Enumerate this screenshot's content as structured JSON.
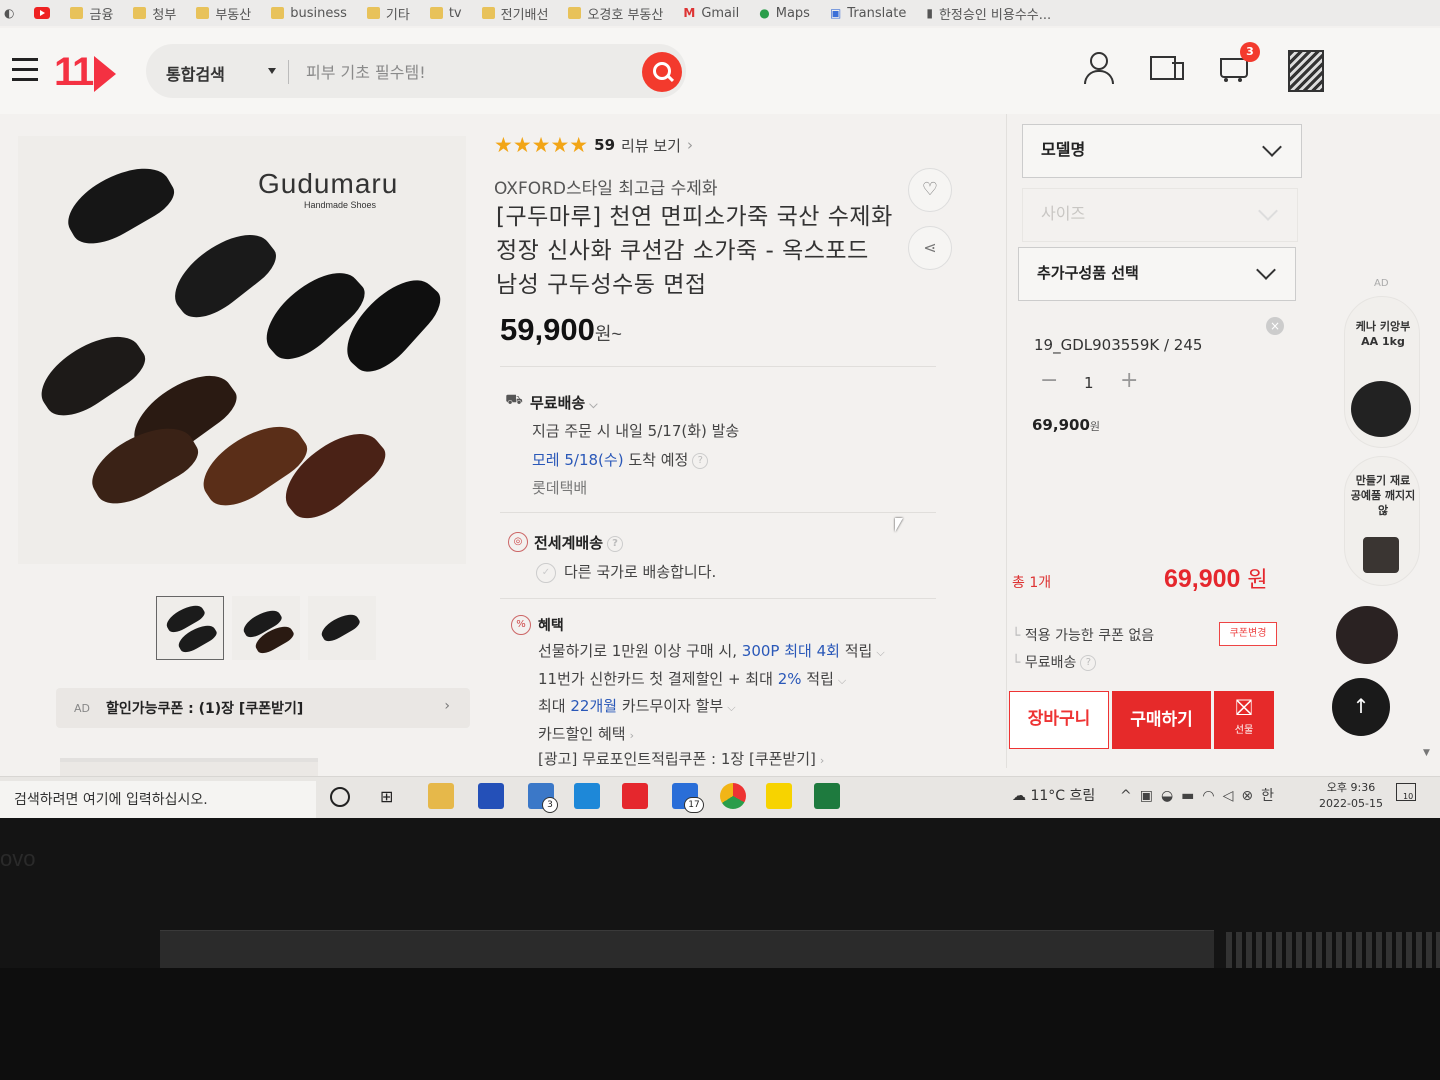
{
  "bookmarks": [
    {
      "label": "금융"
    },
    {
      "label": "청부"
    },
    {
      "label": "부동산"
    },
    {
      "label": "business"
    },
    {
      "label": "기타"
    },
    {
      "label": "tv"
    },
    {
      "label": "전기배선"
    },
    {
      "label": "오경호 부동산"
    },
    {
      "label": "Gmail"
    },
    {
      "label": "Maps"
    },
    {
      "label": "Translate"
    },
    {
      "label": "한정승인 비용수수..."
    }
  ],
  "header": {
    "logo": "11",
    "search_category": "통합검색",
    "search_placeholder": "피부 기초 필수템!",
    "cart_badge": "3"
  },
  "gallery": {
    "brand_name": "Gudumaru",
    "brand_subtitle": "Handmade Shoes",
    "coupon_ad": "AD",
    "coupon_text": "할인가능쿠폰 : (1)장 [쿠폰받기]",
    "thumbnail_count": 3
  },
  "product": {
    "stars": "★★★★★",
    "rating": 4.5,
    "review_count": "59",
    "review_link": "리뷰 보기",
    "subtitle": "OXFORD스타일 최고급 수제화",
    "title": "[구두마루] 천연 면피소가죽 국산 수제화 정장 신사화 쿠션감 소가죽 - 옥스포드 남성 구두성수동 면접",
    "price": "59,900",
    "price_unit": "원~"
  },
  "delivery": {
    "title": "무료배송",
    "line1": "지금 주문 시 내일 5/17(화) 발송",
    "arrival_date": "모레 5/18(수)",
    "arrival_suffix": "도착 예정",
    "carrier": "롯데택배"
  },
  "global_shipping": {
    "title": "전세계배송",
    "line": "다른 국가로 배송합니다."
  },
  "benefits": {
    "title": "혜택",
    "line1_prefix": "선물하기로 1만원 이상 구매 시,",
    "line1_highlight": "300P 최대 4회",
    "line1_suffix": "적립",
    "line2_prefix": "11번가 신한카드 첫 결제할인 + 최대",
    "line2_highlight": "2%",
    "line2_suffix": "적립",
    "line3_prefix": "최대",
    "line3_highlight": "22개월",
    "line3_suffix": "카드무이자 할부",
    "line4": "카드할인 혜택",
    "line5": "[광고] 무료포인트적립쿠폰 : 1장 [쿠폰받기]"
  },
  "options": {
    "model_select": "모델명",
    "size_select": "사이즈",
    "extra_select": "추가구성품 선택",
    "selected_item": "19_GDL903559K / 245",
    "quantity": "1",
    "item_price": "69,900",
    "item_price_unit": "원",
    "total_count": "총 1개",
    "total_price": "69,900",
    "total_unit": "원",
    "coupon_status": "적용 가능한 쿠폰 없음",
    "coupon_change": "쿠폰변경",
    "shipping": "무료배송",
    "cart_button": "장바구니",
    "buy_button": "구매하기",
    "gift_label": "선물"
  },
  "ad_rail": {
    "label": "AD",
    "item1": "케나 키앙부 AA 1kg",
    "item2": "만들기 재료 공예품 깨지지 않"
  },
  "taskbar": {
    "search_placeholder": "검색하려면 여기에 입력하십시오.",
    "mail_badge": "3",
    "app_badge": "17",
    "weather": "11°C 흐림",
    "ime": "한",
    "time": "오후 9:36",
    "date": "2022-05-15",
    "notif_count": "10"
  },
  "bezel": {
    "brand": "ovo"
  },
  "colors": {
    "brand_red": "#f43142",
    "price_red": "#e5272d",
    "link_blue": "#2a58b8",
    "star_gold": "#f2a516"
  }
}
